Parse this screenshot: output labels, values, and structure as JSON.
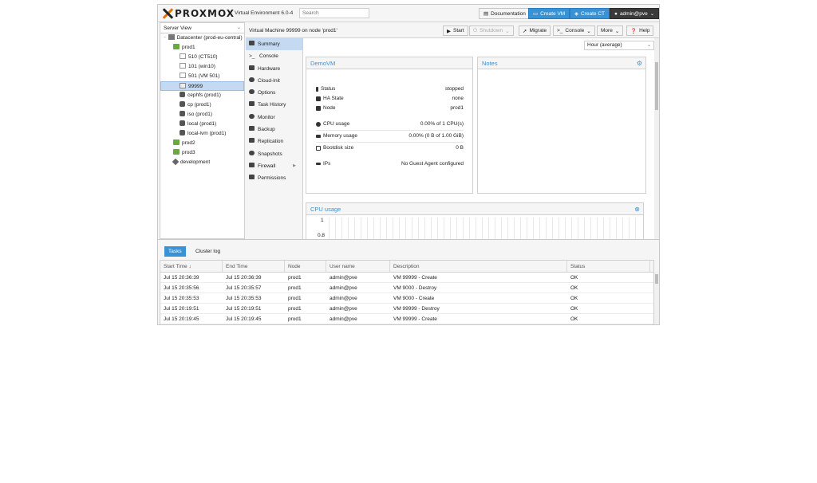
{
  "header": {
    "brand": "PROXMOX",
    "version": "Virtual Environment 6.0-4",
    "search_placeholder": "Search",
    "documentation": "Documentation",
    "create_vm": "Create VM",
    "create_ct": "Create CT",
    "user": "admin@pve"
  },
  "tree": {
    "view": "Server View",
    "nodes": [
      {
        "label": "Datacenter (prod-eu-central)",
        "icon": "datacenter-icon"
      },
      {
        "label": "prod1",
        "icon": "node-icon"
      },
      {
        "label": "510 (CT510)",
        "icon": "container-icon"
      },
      {
        "label": "101 (win10)",
        "icon": "vm-icon"
      },
      {
        "label": "501 (VM 501)",
        "icon": "vm-icon"
      },
      {
        "label": "99999",
        "icon": "vm-icon"
      },
      {
        "label": "cephfs (prod1)",
        "icon": "storage-icon"
      },
      {
        "label": "cp (prod1)",
        "icon": "storage-icon"
      },
      {
        "label": "iso (prod1)",
        "icon": "storage-icon"
      },
      {
        "label": "local (prod1)",
        "icon": "storage-icon"
      },
      {
        "label": "local-lvm (prod1)",
        "icon": "storage-icon"
      },
      {
        "label": "prod2",
        "icon": "node-icon"
      },
      {
        "label": "prod3",
        "icon": "node-icon"
      },
      {
        "label": "development",
        "icon": "tag-icon"
      }
    ]
  },
  "vm": {
    "title": "Virtual Machine 99999 on node 'prod1'",
    "start": "Start",
    "shutdown": "Shutdown",
    "migrate": "Migrate",
    "console": "Console",
    "more": "More",
    "help": "Help"
  },
  "nav": [
    "Summary",
    "Console",
    "Hardware",
    "Cloud-Init",
    "Options",
    "Task History",
    "Monitor",
    "Backup",
    "Replication",
    "Snapshots",
    "Firewall",
    "Permissions"
  ],
  "summary": {
    "timeframe": "Hour (average)",
    "panel_title": "DemoVM",
    "notes_title": "Notes",
    "rows": [
      {
        "label": "Status",
        "value": "stopped"
      },
      {
        "label": "HA State",
        "value": "none"
      },
      {
        "label": "Node",
        "value": "prod1"
      },
      {
        "label": "CPU usage",
        "value": "0.00% of 1 CPU(s)"
      },
      {
        "label": "Memory usage",
        "value": "0.00% (0 B of 1.00 GiB)"
      },
      {
        "label": "Bootdisk size",
        "value": "0 B"
      },
      {
        "label": "IPs",
        "value": "No Guest Agent configured"
      }
    ],
    "cpu_title": "CPU usage",
    "cpu_ticks": [
      "1",
      "0.8"
    ]
  },
  "bottom": {
    "tab_tasks": "Tasks",
    "tab_cluster": "Cluster log",
    "columns": [
      "Start Time",
      "End Time",
      "Node",
      "User name",
      "Description",
      "Status"
    ],
    "rows": [
      [
        "Jul 15 20:36:39",
        "Jul 15 20:36:39",
        "prod1",
        "admin@pve",
        "VM 99999 - Create",
        "OK"
      ],
      [
        "Jul 15 20:35:56",
        "Jul 15 20:35:57",
        "prod1",
        "admin@pve",
        "VM 9000 - Destroy",
        "OK"
      ],
      [
        "Jul 15 20:35:53",
        "Jul 15 20:35:53",
        "prod1",
        "admin@pve",
        "VM 9000 - Create",
        "OK"
      ],
      [
        "Jul 15 20:19:51",
        "Jul 15 20:19:51",
        "prod1",
        "admin@pve",
        "VM 99999 - Destroy",
        "OK"
      ],
      [
        "Jul 15 20:19:45",
        "Jul 15 20:19:45",
        "prod1",
        "admin@pve",
        "VM 99999 - Create",
        "OK"
      ]
    ]
  }
}
